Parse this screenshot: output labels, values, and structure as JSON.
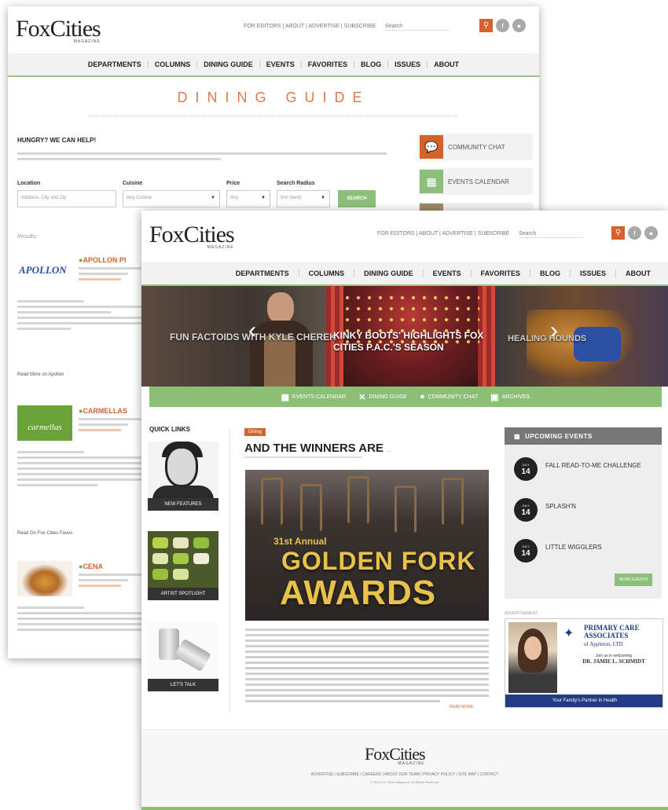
{
  "brand": {
    "logo": "FoxCities",
    "logo_sub": "MAGAZINE"
  },
  "top_links": [
    "FOR EDITORS",
    "ABOUT",
    "ADVERTISE",
    "SUBSCRIBE"
  ],
  "search_placeholder": "Search",
  "nav": [
    "DEPARTMENTS",
    "COLUMNS",
    "DINING GUIDE",
    "EVENTS",
    "FAVORITES",
    "BLOG",
    "ISSUES",
    "ABOUT"
  ],
  "icons": {
    "search": "search-icon",
    "facebook": "facebook-icon",
    "social": "social-icon"
  },
  "colors": {
    "accent_orange": "#d4622b",
    "accent_green": "#8cbf76",
    "nav_bg": "#f2f2f2"
  },
  "dining": {
    "title": "DINING GUIDE",
    "hungry": "HUNGRY? WE CAN HELP!",
    "labels": {
      "location": "Location",
      "cuisine": "Cuisine",
      "price": "Price",
      "radius": "Search Radius"
    },
    "location_placeholder": "Address, City and Zip",
    "cuisine_value": "Any Cuisine",
    "price_value": "Any",
    "radius_value": "5mi (best)",
    "search_button": "SEARCH",
    "results_label": "Results:",
    "sidebar": [
      {
        "label": "COMMUNITY CHAT",
        "icon": "chat-icon",
        "color": "#d4622b"
      },
      {
        "label": "EVENTS CALENDAR",
        "icon": "calendar-icon",
        "color": "#8cc07a"
      }
    ],
    "restaurants": [
      {
        "name": "APOLLON PI",
        "logo_text": "APOLLON",
        "more": "Read More on Apollon"
      },
      {
        "name": "CARMELLAS",
        "logo_text": "carmellas",
        "more": "Read On Fox Cities Faves"
      },
      {
        "name": "CENA",
        "logo_text": "",
        "more": ""
      }
    ]
  },
  "slider": {
    "slides": [
      {
        "title": "FUN FACTOIDS WITH KYLE CHEREK"
      },
      {
        "title": "KINKY BOOTS' HIGHLIGHTS FOX CITIES P.A.C.'S SEASON"
      },
      {
        "title": "HEALING HOUNDS"
      }
    ],
    "prev_icon": "chevron-left-icon",
    "next_icon": "chevron-right-icon"
  },
  "green_bar": [
    {
      "label": "EVENTS CALENDAR",
      "icon": "calendar-icon"
    },
    {
      "label": "DINING GUIDE",
      "icon": "utensils-icon"
    },
    {
      "label": "COMMUNITY CHAT",
      "icon": "chat-icon"
    },
    {
      "label": "ARCHIVES",
      "icon": "archive-icon"
    }
  ],
  "quick_links": {
    "title": "QUICK LINKS",
    "items": [
      {
        "label": "NEW FEATURES"
      },
      {
        "label": "ARTIST SPOTLIGHT"
      },
      {
        "label": "LET'S TALK"
      }
    ]
  },
  "article": {
    "tag": "Dining",
    "title": "AND THE WINNERS ARE",
    "title_suffix": "…",
    "hero": {
      "annual": "31st Annual",
      "line1": "GOLDEN FORK",
      "line2": "AWARDS"
    },
    "read_more": "READ MORE"
  },
  "upcoming": {
    "title": "UPCOMING EVENTS",
    "events": [
      {
        "month": "JULY",
        "day": "14",
        "title": "FALL READ-TO-ME CHALLENGE"
      },
      {
        "month": "JULY",
        "day": "14",
        "title": "SPLASH'N"
      },
      {
        "month": "JULY",
        "day": "14",
        "title": "LITTLE WIGGLERS"
      }
    ],
    "more_label": "MORE EVENTS",
    "advertisement_label": "ADVERTISEMENT"
  },
  "ad": {
    "org": "PRIMARY CARE ASSOCIATES",
    "org_sub": "of Appleton, LTD",
    "welcome": "Join us in welcoming",
    "doctor": "DR. JAMIE L. SCHMIDT",
    "footer": "Your Family's Partner in Health"
  },
  "footer": {
    "links": "ADVERTISE | SUBSCRIBE | CAREERS | ABOUT OUR TEAM | PRIVACY POLICY | SITE MAP | CONTACT",
    "copyright": "© 2015 Fox Cities Magazine. All Rights Reserved."
  }
}
